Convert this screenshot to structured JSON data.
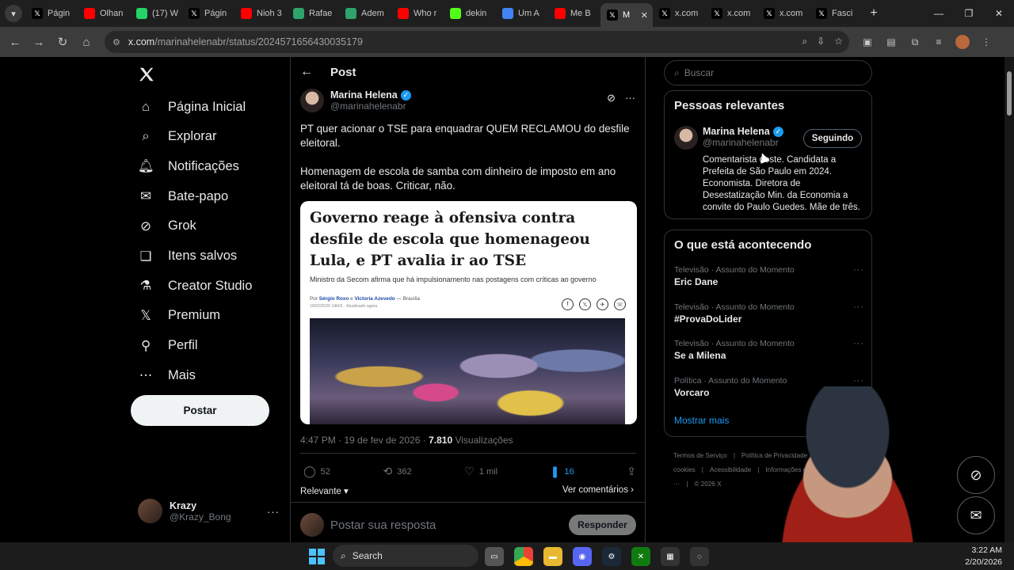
{
  "browser": {
    "tabs": [
      {
        "title": "Págin",
        "favicon": "x-icon",
        "color": "#000000"
      },
      {
        "title": "Olhan",
        "favicon": "youtube-icon",
        "color": "#ff0000"
      },
      {
        "title": "(17) W",
        "favicon": "whatsapp-icon",
        "color": "#25d366"
      },
      {
        "title": "Págin",
        "favicon": "x-icon",
        "color": "#000000"
      },
      {
        "title": "Nioh 3",
        "favicon": "youtube-icon",
        "color": "#ff0000"
      },
      {
        "title": "Rafae",
        "favicon": "feather-icon",
        "color": "#2ea36b"
      },
      {
        "title": "Adem",
        "favicon": "feather-icon",
        "color": "#2ea36b"
      },
      {
        "title": "Who r",
        "favicon": "youtube-icon",
        "color": "#ff0000"
      },
      {
        "title": "dekin",
        "favicon": "k-icon",
        "color": "#53fc18"
      },
      {
        "title": "Um A",
        "favicon": "google-icon",
        "color": "#4285f4"
      },
      {
        "title": "Me B",
        "favicon": "youtube-icon",
        "color": "#ff0000"
      },
      {
        "title": "M",
        "favicon": "x-icon",
        "color": "#000000",
        "active": true
      },
      {
        "title": "x.com",
        "favicon": "x-icon",
        "color": "#000000"
      },
      {
        "title": "x.com",
        "favicon": "x-icon",
        "color": "#000000"
      },
      {
        "title": "x.com",
        "favicon": "x-icon",
        "color": "#000000"
      },
      {
        "title": "Fasci",
        "favicon": "x-icon",
        "color": "#000000"
      }
    ],
    "url_host": "x.com",
    "url_path": "/marinahelenabr/status/2024571656430035179"
  },
  "nav": {
    "items": [
      {
        "label": "Página Inicial",
        "icon": "home-icon"
      },
      {
        "label": "Explorar",
        "icon": "search-icon"
      },
      {
        "label": "Notificações",
        "icon": "bell-icon"
      },
      {
        "label": "Bate-papo",
        "icon": "mail-icon"
      },
      {
        "label": "Grok",
        "icon": "grok-icon"
      },
      {
        "label": "Itens salvos",
        "icon": "bookmark-icon"
      },
      {
        "label": "Creator Studio",
        "icon": "flask-icon"
      },
      {
        "label": "Premium",
        "icon": "x-icon"
      },
      {
        "label": "Perfil",
        "icon": "person-icon"
      },
      {
        "label": "Mais",
        "icon": "more-circle-icon"
      }
    ],
    "post_button": "Postar",
    "me": {
      "name": "Krazy",
      "handle": "@Krazy_Bong"
    }
  },
  "post": {
    "header": "Post",
    "author_name": "Marina Helena",
    "author_handle": "@marinahelenabr",
    "text1": "PT quer acionar o TSE para enquadrar QUEM RECLAMOU do desfile eleitoral.",
    "text2": "Homenagem de escola de samba com dinheiro de imposto em ano eleitoral tá de boas. Criticar, não.",
    "card": {
      "headline": "Governo reage à ofensiva contra desfile de escola que homenageou Lula, e PT avalia ir ao TSE",
      "sub": "Ministro da Secom afirma que há impulsionamento nas postagens com críticas ao governo",
      "by_prefix": "Por",
      "author1": "Sérgio Roxo",
      "by_and": "e",
      "author2": "Victoria Azevedo",
      "location": "— Brasília",
      "dateline": "19/02/2026 14h01 · Atualizado agora"
    },
    "time": "4:47 PM · 19 de fev de 2026 · ",
    "views_count": "7.810",
    "views_label": " Visualizações",
    "replies": "52",
    "reposts": "362",
    "likes": "1 mil",
    "bookmarks": "16",
    "sort_label": "Relevante",
    "see_comments": "Ver comentários",
    "reply_placeholder": "Postar sua resposta",
    "reply_button": "Responder"
  },
  "sidebar": {
    "search_placeholder": "Buscar",
    "relevant_title": "Pessoas relevantes",
    "relevant_user": {
      "name": "Marina Helena",
      "handle": "@marinahelenabr",
      "follow_label": "Seguindo",
      "bio": "Comentarista deste. Candidata a Prefeita de São Paulo em 2024. Economista. Diretora de Desestatização Min. da Economia a convite do Paulo Guedes. Mãe de três."
    },
    "trends_title": "O que está acontecendo",
    "trends": [
      {
        "category": "Televisão · Assunto do Momento",
        "name": "Eric Dane"
      },
      {
        "category": "Televisão · Assunto do Momento",
        "name": "#ProvaDoLider"
      },
      {
        "category": "Televisão · Assunto do Momento",
        "name": "Se a Milena"
      },
      {
        "category": "Política · Assunto do Momento",
        "name": "Vorcaro"
      }
    ],
    "show_more": "Mostrar mais",
    "footer": [
      "Termos de Serviço",
      "Política de Privacidade",
      "Política de cookies",
      "Acessibilidade",
      "Informações de anúncios",
      "Mais ···",
      "© 2026 X"
    ]
  },
  "taskbar": {
    "search_label": "Search",
    "time": "3:22 AM",
    "date": "2/20/2026"
  },
  "colors": {
    "accent": "#1d9bf0",
    "background": "#000000",
    "border": "#2f3336"
  }
}
